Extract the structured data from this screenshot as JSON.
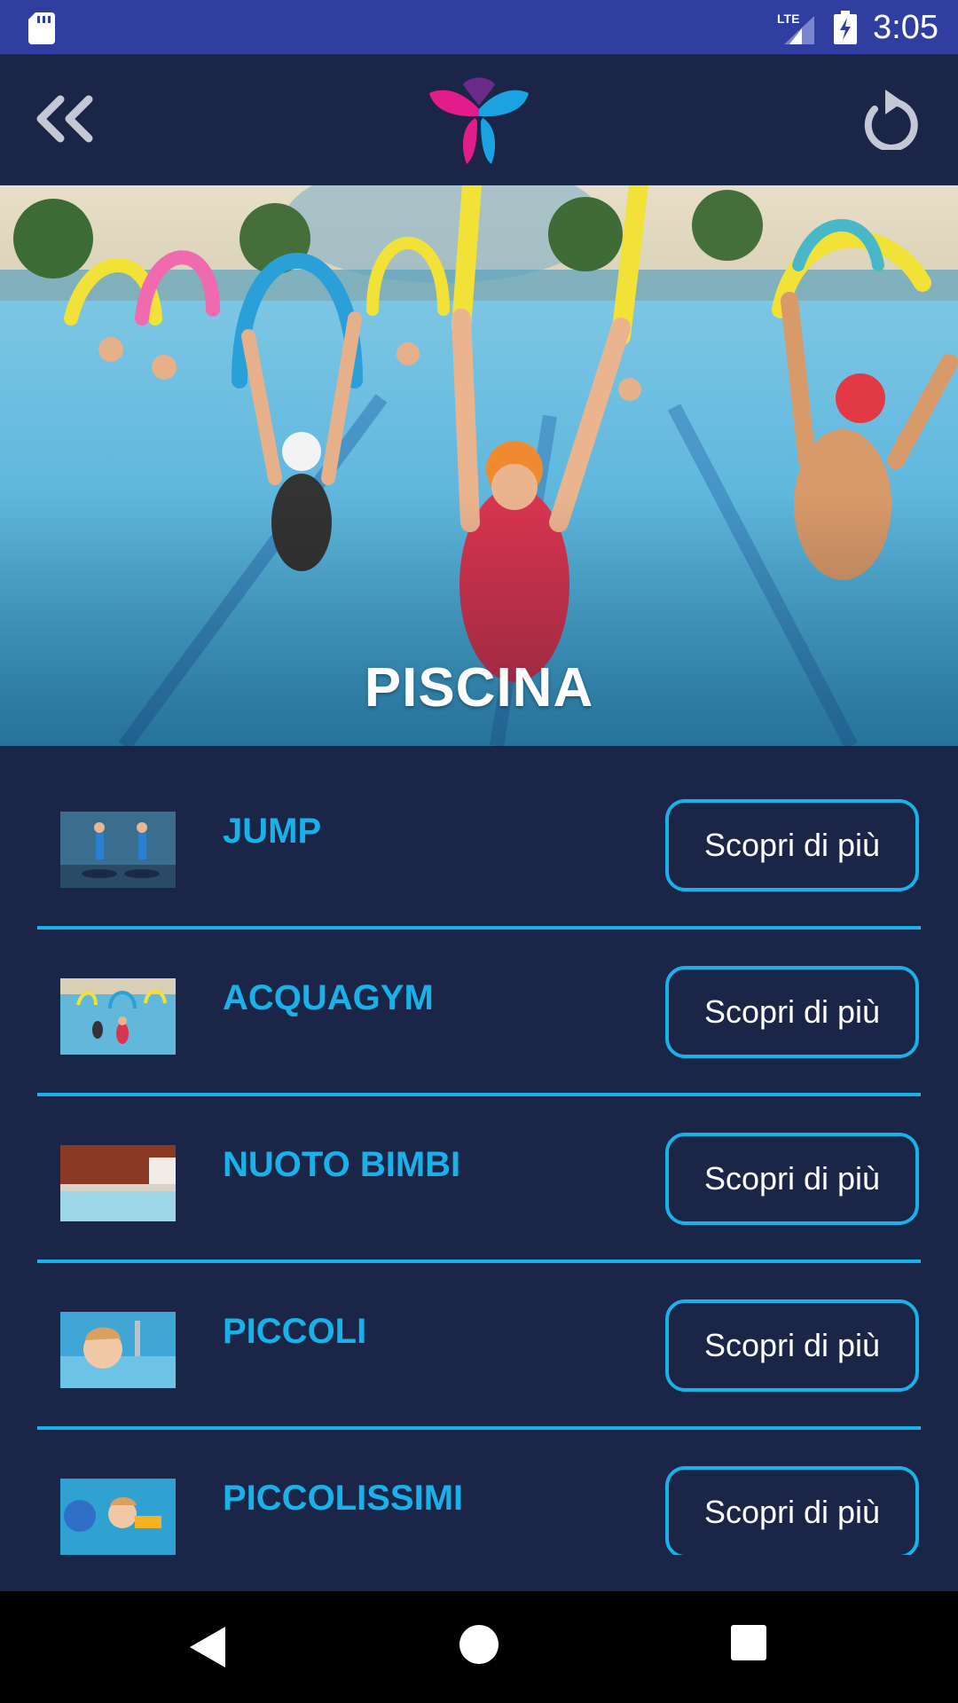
{
  "status_bar": {
    "time": "3:05",
    "network": "LTE"
  },
  "header": {
    "back_icon": "double-chevron-left-icon",
    "logo": "app-logo",
    "refresh_icon": "refresh-icon"
  },
  "hero": {
    "title": "PISCINA"
  },
  "list": {
    "items": [
      {
        "title": "JUMP",
        "button": "Scopri di più"
      },
      {
        "title": "ACQUAGYM",
        "button": "Scopri di più"
      },
      {
        "title": "NUOTO BIMBI",
        "button": "Scopri di più"
      },
      {
        "title": "PICCOLI",
        "button": "Scopri di più"
      },
      {
        "title": "PICCOLISSIMI",
        "button": "Scopri di più"
      }
    ]
  },
  "colors": {
    "background": "#1b2548",
    "accent": "#1ab0e8",
    "status_bar": "#303f9f"
  }
}
